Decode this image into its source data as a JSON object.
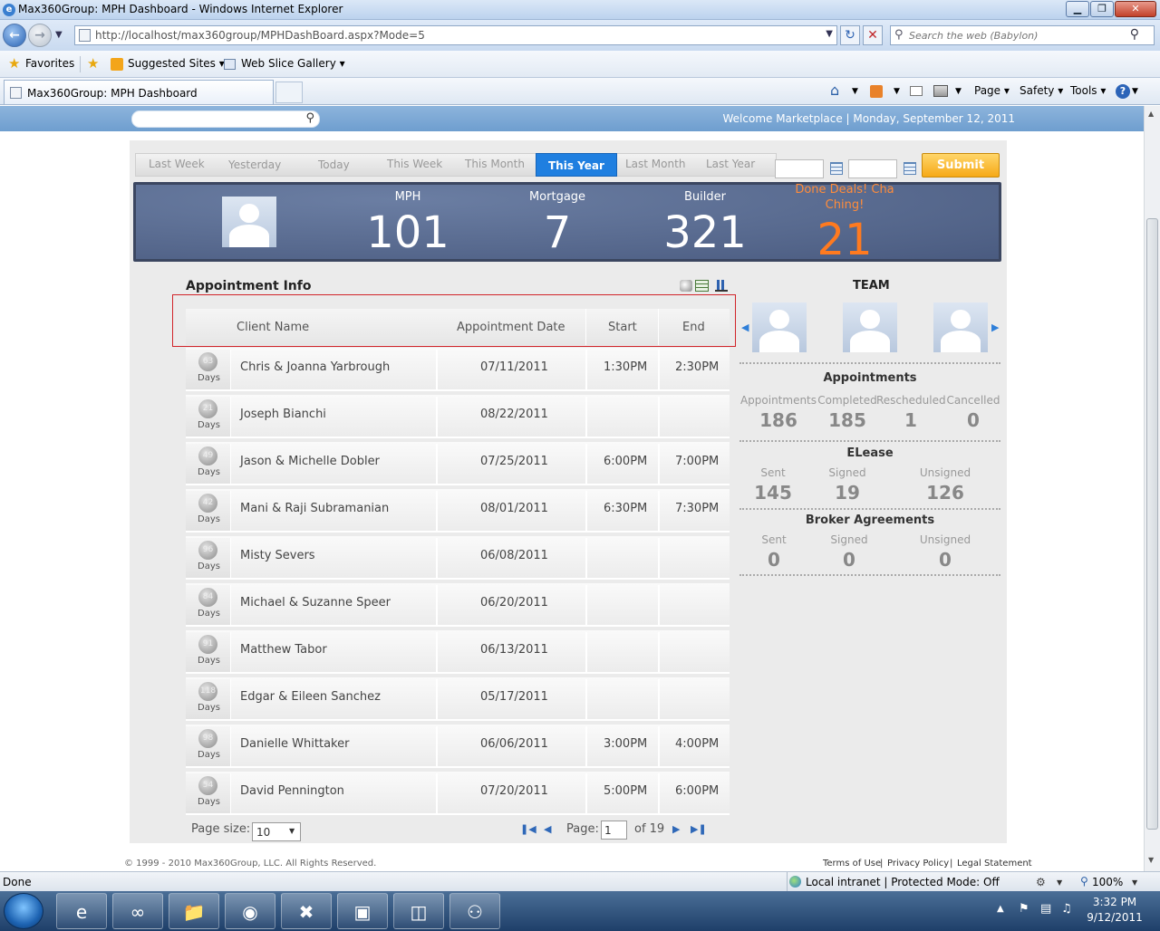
{
  "window": {
    "title": "Max360Group: MPH Dashboard - Windows Internet Explorer",
    "minimize": "▁",
    "maximize": "❐",
    "close": "✕"
  },
  "addressbar": {
    "url": "http://localhost/max360group/MPHDashBoard.aspx?Mode=5",
    "search_placeholder": "Search the web (Babylon)"
  },
  "favorites_bar": {
    "favorites": "Favorites",
    "suggested_sites": "Suggested Sites ▾",
    "web_slice_gallery": "Web Slice Gallery ▾"
  },
  "tabs": {
    "active": "Max360Group: MPH Dashboard"
  },
  "command_bar": {
    "page": "Page ▾",
    "safety": "Safety ▾",
    "tools": "Tools ▾"
  },
  "header": {
    "welcome": "Welcome Marketplace | Monday, September 12, 2011"
  },
  "range_tabs": [
    "Last Week",
    "Yesterday",
    "Today",
    "This Week",
    "This Month",
    "This Year",
    "Last Month",
    "Last Year"
  ],
  "range_active": "This Year",
  "submit_label": "Submit",
  "stats": {
    "mph_label": "MPH",
    "mph_value": "101",
    "mortgage_label": "Mortgage",
    "mortgage_value": "7",
    "builder_label": "Builder",
    "builder_value": "321",
    "done_label": "Done Deals! Cha Ching!",
    "done_value": "21"
  },
  "appointments": {
    "title": "Appointment Info",
    "columns": {
      "client": "Client Name",
      "date": "Appointment Date",
      "start": "Start",
      "end": "End"
    },
    "days_label": "Days",
    "rows": [
      {
        "days": "63",
        "name": "Chris & Joanna Yarbrough",
        "date": "07/11/2011",
        "start": "1:30PM",
        "end": "2:30PM"
      },
      {
        "days": "21",
        "name": "Joseph Bianchi",
        "date": "08/22/2011",
        "start": "",
        "end": ""
      },
      {
        "days": "49",
        "name": "Jason & Michelle Dobler",
        "date": "07/25/2011",
        "start": "6:00PM",
        "end": "7:00PM"
      },
      {
        "days": "42",
        "name": "Mani & Raji Subramanian",
        "date": "08/01/2011",
        "start": "6:30PM",
        "end": "7:30PM"
      },
      {
        "days": "96",
        "name": "Misty Severs",
        "date": "06/08/2011",
        "start": "",
        "end": ""
      },
      {
        "days": "84",
        "name": "Michael & Suzanne Speer",
        "date": "06/20/2011",
        "start": "",
        "end": ""
      },
      {
        "days": "91",
        "name": "Matthew Tabor",
        "date": "06/13/2011",
        "start": "",
        "end": ""
      },
      {
        "days": "118",
        "name": "Edgar & Eileen Sanchez",
        "date": "05/17/2011",
        "start": "",
        "end": ""
      },
      {
        "days": "98",
        "name": "Danielle Whittaker",
        "date": "06/06/2011",
        "start": "3:00PM",
        "end": "4:00PM"
      },
      {
        "days": "54",
        "name": "David Pennington",
        "date": "07/20/2011",
        "start": "5:00PM",
        "end": "6:00PM"
      }
    ]
  },
  "pager": {
    "page_size_label": "Page size:",
    "page_size_value": "10",
    "page_label": "Page:",
    "page_value": "1",
    "of_label": "of 19"
  },
  "team": {
    "title": "TEAM",
    "appointments": {
      "title": "Appointments",
      "labels": [
        "Appointments",
        "Completed",
        "Rescheduled",
        "Cancelled"
      ],
      "values": [
        "186",
        "185",
        "1",
        "0"
      ]
    },
    "elease": {
      "title": "ELease",
      "labels": [
        "Sent",
        "Signed",
        "Unsigned"
      ],
      "values": [
        "145",
        "19",
        "126"
      ]
    },
    "broker": {
      "title": "Broker Agreements",
      "labels": [
        "Sent",
        "Signed",
        "Unsigned"
      ],
      "values": [
        "0",
        "0",
        "0"
      ]
    }
  },
  "footer": {
    "copyright": "© 1999 - 2010 Max360Group, LLC. All Rights Reserved.",
    "terms": "Terms of Use",
    "privacy": "Privacy Policy",
    "legal": "Legal Statement",
    "sep": "|"
  },
  "statusbar": {
    "status": "Done",
    "zone": "Local intranet | Protected Mode: Off",
    "zoom": "100%"
  },
  "taskbar": {
    "time": "3:32 PM",
    "date": "9/12/2011"
  }
}
